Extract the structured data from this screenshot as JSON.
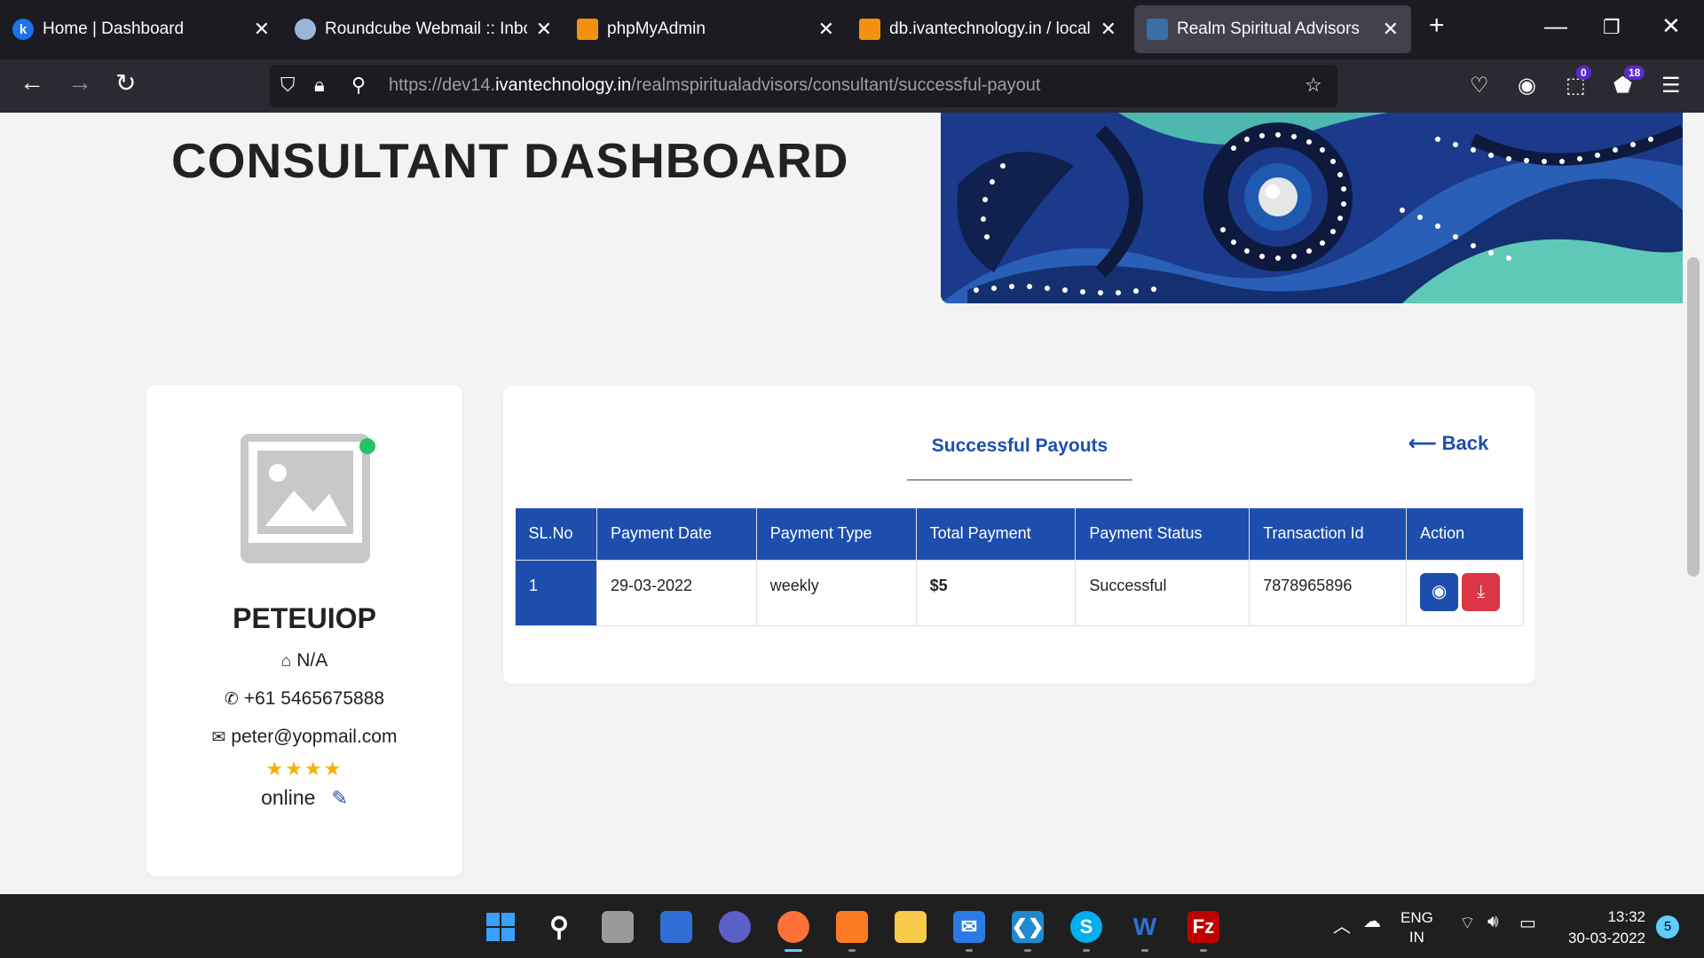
{
  "browser": {
    "tabs": [
      {
        "title": "Home | Dashboard",
        "favicon": "k",
        "favicon_color": "#1a73e8"
      },
      {
        "title": "Roundcube Webmail :: Inbox",
        "favicon": "",
        "favicon_color": "#9ab6d8"
      },
      {
        "title": "phpMyAdmin",
        "favicon": "",
        "favicon_color": "#f29111"
      },
      {
        "title": "db.ivantechnology.in / localh",
        "favicon": "",
        "favicon_color": "#f29111"
      },
      {
        "title": "Realm Spiritual Advisors",
        "favicon": "",
        "favicon_color": "#3a6ea5"
      }
    ],
    "new_tab": "+",
    "url_prefix": "https://dev14.",
    "url_domain": "ivantechnology.in",
    "url_path": "/realmspiritualadvisors/consultant/successful-payout",
    "ext_badge_1": "0",
    "ext_badge_2": "18"
  },
  "page": {
    "title": "CONSULTANT DASHBOARD",
    "profile": {
      "name": "PETEUIOP",
      "address": "N/A",
      "phone": "+61 5465675888",
      "email": "peter@yopmail.com",
      "rating_stars": 4,
      "stars_text": "★★★★",
      "status": "online"
    },
    "payouts": {
      "heading": "Successful Payouts",
      "back_label": "Back",
      "columns": [
        "SL.No",
        "Payment Date",
        "Payment Type",
        "Total Payment",
        "Payment Status",
        "Transaction Id",
        "Action"
      ],
      "rows": [
        {
          "sl": "1",
          "date": "29-03-2022",
          "type": "weekly",
          "total": "$5",
          "status": "Successful",
          "transaction_id": "7878965896"
        }
      ]
    },
    "floating": {
      "count": "0",
      "top_label": "⤒"
    }
  },
  "taskbar": {
    "lang_top": "ENG",
    "lang_bottom": "IN",
    "time": "13:32",
    "date": "30-03-2022",
    "notifications": "5"
  },
  "colors": {
    "primary": "#1d4eae",
    "danger": "#dc3545",
    "online": "#22c55e",
    "star": "#f5b301"
  }
}
